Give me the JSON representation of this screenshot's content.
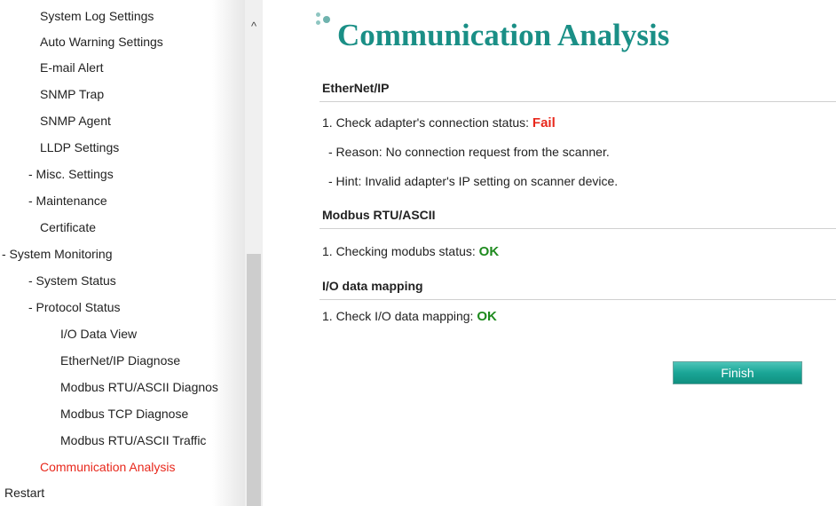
{
  "sidebar": {
    "items": [
      {
        "label": "System Log Settings"
      },
      {
        "label": "Auto Warning Settings"
      },
      {
        "label": "E-mail Alert"
      },
      {
        "label": "SNMP Trap"
      },
      {
        "label": "SNMP Agent"
      },
      {
        "label": "LLDP Settings"
      },
      {
        "label": "- Misc. Settings"
      },
      {
        "label": "- Maintenance"
      },
      {
        "label": "Certificate"
      },
      {
        "label": "- System Monitoring"
      },
      {
        "label": "- System Status"
      },
      {
        "label": "- Protocol Status"
      },
      {
        "label": "I/O Data View"
      },
      {
        "label": "EtherNet/IP Diagnose"
      },
      {
        "label": "Modbus RTU/ASCII Diagnos"
      },
      {
        "label": "Modbus TCP Diagnose"
      },
      {
        "label": "Modbus RTU/ASCII Traffic"
      },
      {
        "label": "Communication Analysis",
        "active": true
      },
      {
        "label": "Restart"
      }
    ],
    "scroll_up_icon": "^"
  },
  "main": {
    "title": "Communication Analysis",
    "sections": [
      {
        "header": "EtherNet/IP",
        "check_label": "1. Check adapter's connection status:",
        "status": "Fail",
        "reason": "- Reason: No connection request from the scanner.",
        "hint": "- Hint: Invalid adapter's IP setting on scanner device."
      },
      {
        "header": "Modbus RTU/ASCII",
        "check_label": "1. Checking modubs status:",
        "status": "OK"
      },
      {
        "header": "I/O data mapping",
        "check_label": "1. Check I/O data mapping:",
        "status": "OK"
      }
    ],
    "finish_label": "Finish"
  },
  "colors": {
    "title": "#1a8f86",
    "active_nav": "#e8281c",
    "fail": "#e8281c",
    "ok": "#1e8a1e",
    "button": "#1aa596"
  }
}
